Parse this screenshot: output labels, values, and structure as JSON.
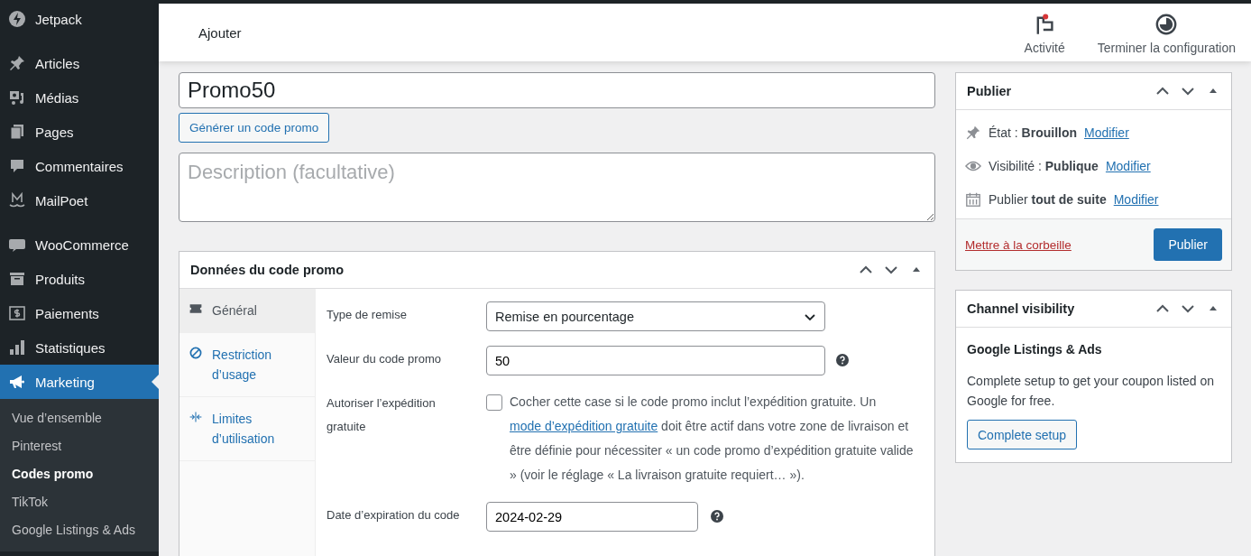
{
  "sidebar": {
    "items": [
      {
        "label": "Jetpack",
        "kind": "bolt",
        "selected": false,
        "separator_after": true
      },
      {
        "label": "Articles",
        "kind": "pin",
        "selected": false,
        "separator_after": false
      },
      {
        "label": "Médias",
        "kind": "media",
        "selected": false,
        "separator_after": false
      },
      {
        "label": "Pages",
        "kind": "pages",
        "selected": false,
        "separator_after": false
      },
      {
        "label": "Commentaires",
        "kind": "comment",
        "selected": false,
        "separator_after": false
      },
      {
        "label": "MailPoet",
        "kind": "mailpoet",
        "selected": false,
        "separator_after": true
      },
      {
        "label": "WooCommerce",
        "kind": "woo",
        "selected": false,
        "separator_after": false
      },
      {
        "label": "Produits",
        "kind": "box",
        "selected": false,
        "separator_after": false
      },
      {
        "label": "Paiements",
        "kind": "dollar",
        "selected": false,
        "separator_after": false
      },
      {
        "label": "Statistiques",
        "kind": "bars",
        "selected": false,
        "separator_after": false
      },
      {
        "label": "Marketing",
        "kind": "megaphone",
        "selected": true,
        "separator_after": false
      }
    ],
    "submenu": [
      {
        "label": "Vue d’ensemble",
        "selected": false
      },
      {
        "label": "Pinterest",
        "selected": false
      },
      {
        "label": "Codes promo",
        "selected": true
      },
      {
        "label": "TikTok",
        "selected": false
      },
      {
        "label": "Google Listings & Ads",
        "selected": false
      }
    ]
  },
  "topbar": {
    "title": "Ajouter",
    "actions": [
      {
        "label": "Activité",
        "kind": "flag"
      },
      {
        "label": "Terminer la configuration",
        "kind": "progress"
      }
    ]
  },
  "coupon_code": {
    "value": "Promo50"
  },
  "generate_button": "Générer un code promo",
  "description": {
    "placeholder": "Description (facultative)"
  },
  "coupon_data": {
    "title": "Données du code promo",
    "tabs": [
      {
        "label": "Général",
        "kind": "ticket",
        "selected": true
      },
      {
        "label": "Restriction d’usage",
        "kind": "block",
        "selected": false
      },
      {
        "label": "Limites d’utilisation",
        "kind": "limits",
        "selected": false
      }
    ],
    "fields": [
      {
        "kind": "select",
        "label": "Type de remise",
        "value": "Remise en pourcentage",
        "help": false
      },
      {
        "kind": "input",
        "label": "Valeur du code promo",
        "value": "50",
        "help": true
      },
      {
        "kind": "checkbox",
        "label": "Autoriser l’expédition gratuite",
        "checked": false,
        "text_before": "Cocher cette case si le code promo inclut l’expédition gratuite. Un ",
        "link": "mode d’expédition gratuite",
        "text_after": " doit être actif dans votre zone de livraison et être définie pour nécessiter « un code promo d’expédition gratuite valide » (voir le réglage « La livraison gratuite requiert… »)."
      },
      {
        "kind": "date",
        "label": "Date d’expiration du code",
        "value": "2024-02-29",
        "help": true
      }
    ]
  },
  "publish_box": {
    "title": "Publier",
    "rows": [
      {
        "kind": "pin",
        "text": "État : **Brouillon**",
        "link": "Modifier"
      },
      {
        "kind": "eye",
        "text": "Visibilité : **Publique**",
        "link": "Modifier"
      },
      {
        "kind": "calendar",
        "text": "Publier **tout de suite**",
        "link": "Modifier"
      }
    ],
    "trash_link": "Mettre à la corbeille",
    "publish_button": "Publier"
  },
  "channel_box": {
    "title": "Channel visibility",
    "heading": "Google Listings & Ads",
    "text": "Complete setup to get your coupon listed on Google for free.",
    "button": "Complete setup"
  }
}
